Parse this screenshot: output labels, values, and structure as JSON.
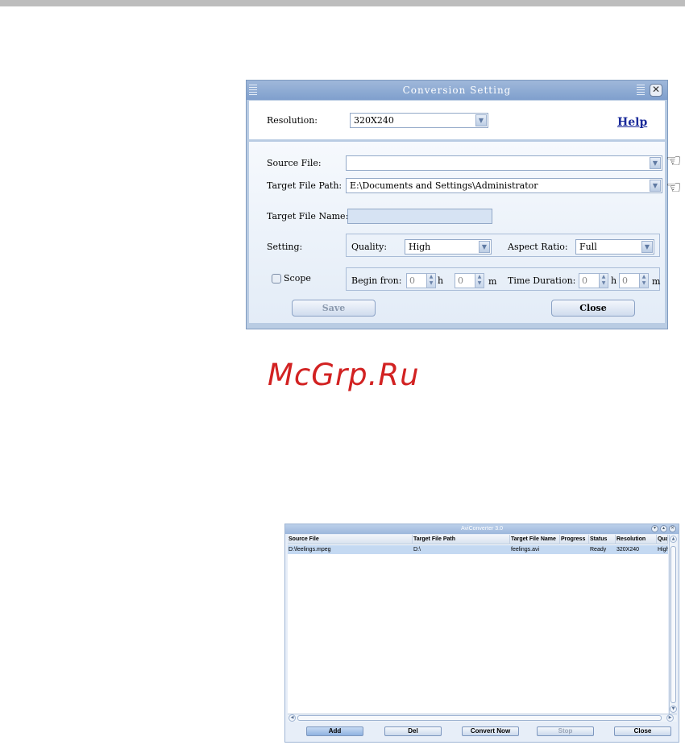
{
  "dialog": {
    "title": "Conversion Setting",
    "close_icon": "close-icon",
    "resolution_label": "Resolution:",
    "resolution_value": "320X240",
    "help_label": "Help",
    "source_file_label": "Source File:",
    "source_file_value": "",
    "target_path_label": "Target File Path:",
    "target_path_value": "E:\\Documents and Settings\\Administrator",
    "target_name_label": "Target File Name:",
    "target_name_value": "",
    "setting_label": "Setting:",
    "quality_label": "Quality:",
    "quality_value": "High",
    "aspect_label": "Aspect Ratio:",
    "aspect_value": "Full",
    "scope_label": "Scope",
    "scope_checked": false,
    "begin_label": "Begin fron:",
    "begin_h_value": "0",
    "h_unit": "h",
    "begin_m_value": "0",
    "m_unit": "m",
    "duration_label": "Time Duration:",
    "duration_h_value": "0",
    "duration_m_value": "0",
    "save_label": "Save",
    "close_label": "Close"
  },
  "watermark": "McGrp.Ru",
  "main_window": {
    "title": "AviConverter 3.0",
    "columns": [
      "Source File",
      "Target File Path",
      "Target File Name",
      "Progress",
      "Status",
      "Resolution",
      "Qual"
    ],
    "rows": [
      [
        "D:\\feelings.mpeg",
        "D:\\",
        "feelings.avi",
        "",
        "Ready",
        "320X240",
        "High"
      ]
    ],
    "buttons": {
      "add": "Add",
      "del": "Del",
      "convert_now": "Convert Now",
      "stop": "Stop",
      "close": "Close"
    }
  }
}
